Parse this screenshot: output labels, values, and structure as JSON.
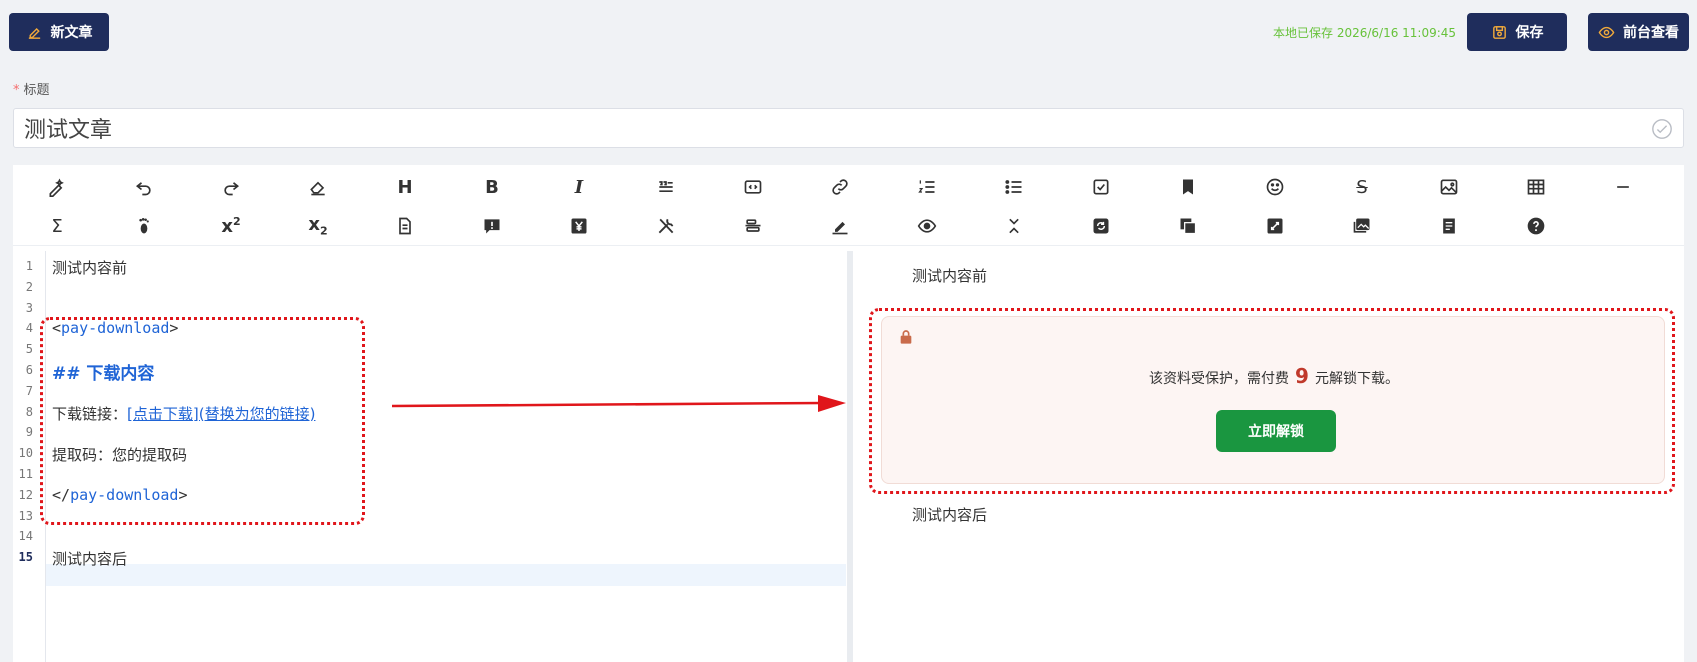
{
  "topbar": {
    "new_article_label": "新文章",
    "saved_status": "本地已保存 2026/6/16 11:09:45",
    "save_label": "保存",
    "view_frontend_label": "前台查看"
  },
  "title_field": {
    "label": "标题",
    "required_mark": "*",
    "value": "测试文章"
  },
  "toolbar": {
    "row1": [
      "magic-pen-icon",
      "undo-icon",
      "redo-icon",
      "eraser-icon",
      "heading-icon",
      "bold-icon",
      "italic-icon",
      "quote-icon",
      "code-icon",
      "link-icon",
      "ordered-list-icon",
      "unordered-list-icon",
      "checkbox-icon",
      "bookmark-icon",
      "emoji-icon",
      "strikethrough-icon",
      "image-icon",
      "table-icon",
      "horizontal-rule-icon"
    ],
    "row2": [
      "sigma-icon",
      "footprint-icon",
      "superscript-icon",
      "subscript-icon",
      "document-icon",
      "alert-icon",
      "yuan-icon",
      "tools-icon",
      "align-icon",
      "highlight-icon",
      "preview-icon",
      "collapse-icon",
      "refresh-icon",
      "copy-icon",
      "fullscreen-icon",
      "gallery-icon",
      "note-icon",
      "help-icon"
    ]
  },
  "editor": {
    "lines": [
      {
        "n": "1",
        "text": "测试内容前"
      },
      {
        "n": "2",
        "text": ""
      },
      {
        "n": "3",
        "text": ""
      },
      {
        "n": "4",
        "open": "<",
        "tag": "pay-download",
        "close": ">"
      },
      {
        "n": "5",
        "text": ""
      },
      {
        "n": "6",
        "heading": "##  下载内容"
      },
      {
        "n": "7",
        "text": ""
      },
      {
        "n": "8",
        "prefix": "下载链接：",
        "link": "[点击下载](替换为您的链接)"
      },
      {
        "n": "9",
        "text": ""
      },
      {
        "n": "10",
        "text": "提取码：您的提取码"
      },
      {
        "n": "11",
        "text": ""
      },
      {
        "n": "12",
        "open": "</",
        "tag": "pay-download",
        "close": ">"
      },
      {
        "n": "13",
        "text": ""
      },
      {
        "n": "14",
        "text": ""
      },
      {
        "n": "15",
        "text": "测试内容后"
      }
    ],
    "active_line": "15"
  },
  "preview": {
    "before": "测试内容前",
    "after": "测试内容后",
    "pay_box": {
      "msg_prefix": "该资料受保护，需付费",
      "price": "9",
      "msg_suffix": "元解锁下载。",
      "unlock_label": "立即解锁"
    }
  },
  "colors": {
    "primary": "#1f2d5c",
    "saved": "#67c23a",
    "annotation": "#e0161b",
    "unlock": "#1a9640",
    "price": "#c0392b"
  }
}
